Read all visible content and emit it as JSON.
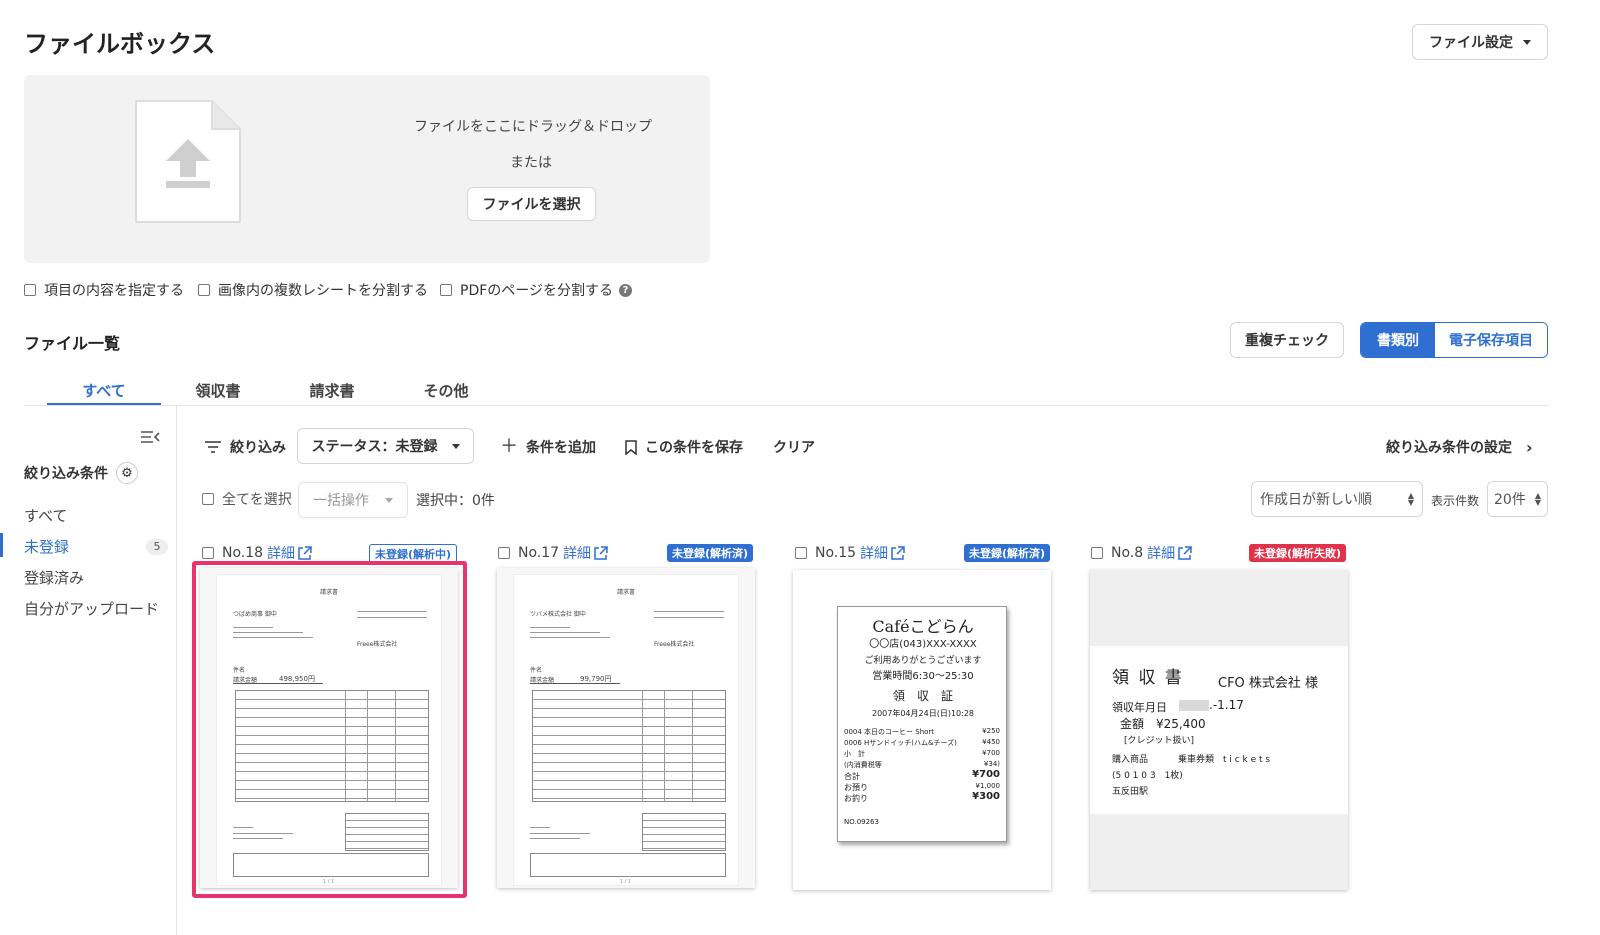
{
  "page": {
    "title": "ファイルボックス",
    "settings_button": "ファイル設定"
  },
  "upload": {
    "drop_text": "ファイルをここにドラッグ＆ドロップ",
    "or_text": "または",
    "select_button": "ファイルを選択"
  },
  "options": [
    {
      "label": "項目の内容を指定する"
    },
    {
      "label": "画像内の複数レシートを分割する"
    },
    {
      "label": "PDFのページを分割する"
    }
  ],
  "file_list": {
    "title": "ファイル一覧",
    "dup_check": "重複チェック",
    "view_by_type": "書類別",
    "view_by_storage": "電子保存項目"
  },
  "tabs": [
    {
      "label": "すべて"
    },
    {
      "label": "領収書"
    },
    {
      "label": "請求書"
    },
    {
      "label": "その他"
    }
  ],
  "sidebar": {
    "heading": "絞り込み条件",
    "items": [
      {
        "label": "すべて",
        "count": ""
      },
      {
        "label": "未登録",
        "count": "5"
      },
      {
        "label": "登録済み",
        "count": ""
      },
      {
        "label": "自分がアップロード",
        "count": ""
      }
    ]
  },
  "filter": {
    "filter_label": "絞り込み",
    "status_select": "ステータス：未登録",
    "add_condition": "条件を追加",
    "save_condition": "この条件を保存",
    "clear": "クリア",
    "settings_link": "絞り込み条件の設定"
  },
  "bulk": {
    "select_all": "全てを選択",
    "bulk_action": "一括操作",
    "selected": "選択中：0件",
    "sort": "作成日が新しい順",
    "per_page_label": "表示件数",
    "per_page": "20件"
  },
  "cards": [
    {
      "no": "No.18",
      "detail": "詳細",
      "status": "未登録(解析中)",
      "status_color": "#2f6fd1",
      "selected": true
    },
    {
      "no": "No.17",
      "detail": "詳細",
      "status": "未登録(解析済)",
      "status_color": "#2f6fd1",
      "selected": false
    },
    {
      "no": "No.15",
      "detail": "詳細",
      "status": "未登録(解析済)",
      "status_color": "#2f6fd1",
      "selected": false
    },
    {
      "no": "No.8",
      "detail": "詳細",
      "status": "未登録(解析失敗)",
      "status_color": "#e0324b",
      "selected": false
    }
  ],
  "invoice1": {
    "title": "請求書",
    "to": "つばめ商事 御中",
    "company": "Freee株式会社",
    "subject": "件名",
    "amount_label": "請求金額",
    "amount": "498,950円",
    "page": "1 / 1"
  },
  "invoice2": {
    "title": "請求書",
    "to": "ツバメ株式会社 御中",
    "company": "Freee株式会社",
    "subject": "件名",
    "amount_label": "請求金額",
    "amount": "99,790円",
    "page": "1 / 1"
  },
  "receipt_cafe": {
    "shop": "Caféこどらん",
    "branch": "〇〇店(043)XXX-XXXX",
    "thanks": "ご利用ありがとうございます",
    "hours": "営業時間6:30〜25:30",
    "title": "領　収　証",
    "date": "2007年04月24日(日)10:28",
    "lines": [
      {
        "name": "0004 本日のコーヒー Short",
        "price": "¥250"
      },
      {
        "name": "0006 Hサンドイッチ(ハム&チーズ)",
        "price": "¥450"
      },
      {
        "name": "小　計",
        "price": "¥700"
      },
      {
        "name": "(内消費税等",
        "price": "¥34)"
      },
      {
        "name": "合計",
        "price": "¥700"
      },
      {
        "name": "お預り",
        "price": "¥1,000"
      },
      {
        "name": "お釣り",
        "price": "¥300"
      }
    ],
    "no": "NO.09263"
  },
  "receipt_ticket": {
    "title": "領 収 書",
    "to": "CFO 株式会社 様",
    "date_label": "領収年月日",
    "date_value": ".-1.17",
    "amount": "金額　¥25,400",
    "credit": "[クレジット扱い]",
    "item_label": "購入商品",
    "item_value": "乗車券類　t i c k e t s",
    "count": "(5 0 1 0 3　1枚)",
    "station": "五反田駅"
  }
}
